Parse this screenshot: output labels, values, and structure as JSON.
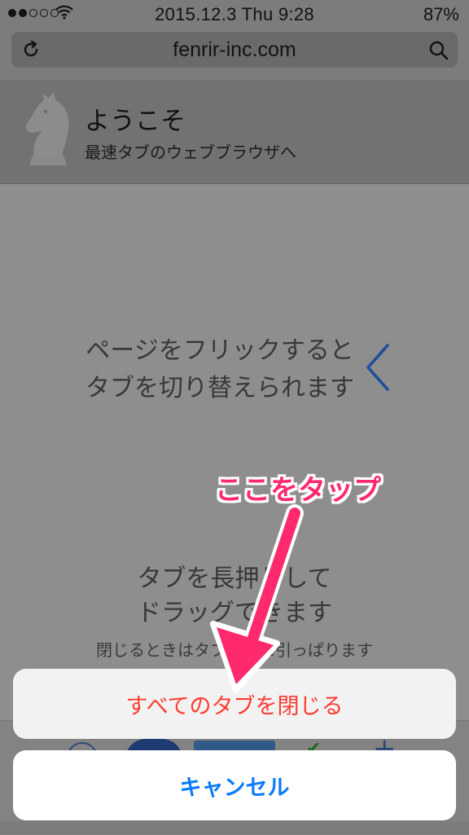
{
  "status_bar": {
    "signal": {
      "filled": 2,
      "total": 5
    },
    "time": "2015.12.3 Thu 9:28",
    "battery": "87%"
  },
  "address_bar": {
    "url": "fenrir-inc.com",
    "icons": [
      "reload-icon",
      "search-icon"
    ]
  },
  "welcome": {
    "title": "ようこそ",
    "subtitle": "最速タブのウェブブラウザへ",
    "icon": "knight-icon"
  },
  "hints": {
    "flick_line1": "ページをフリックすると",
    "flick_line2": "タブを切り替えられます",
    "drag_line1": "タブを長押しして",
    "drag_line2": "ドラッグできます",
    "close_hint": "閉じるときはタブを下に引っぱります"
  },
  "annotation": {
    "callout": "ここをタップ",
    "color": "#ff2a6d"
  },
  "action_sheet": {
    "close_all_label": "すべてのタブを閉じる",
    "cancel_label": "キャンセル",
    "destructive_color": "#ff3b30",
    "cancel_color": "#0a7aff"
  }
}
